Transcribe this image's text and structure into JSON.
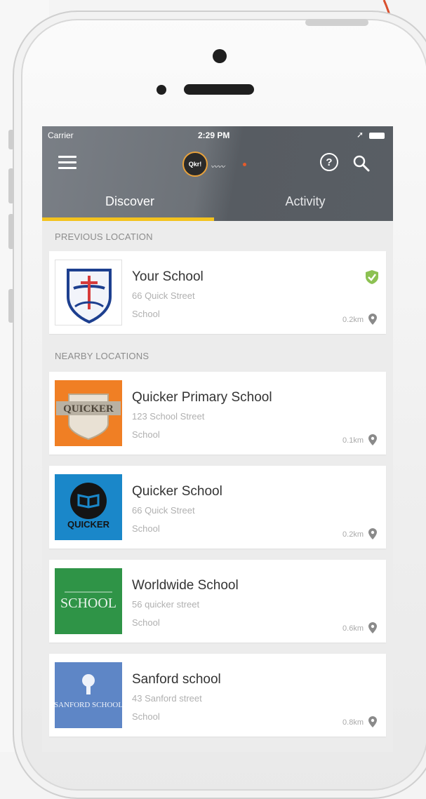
{
  "status_bar": {
    "carrier": "Carrier",
    "time": "2:29 PM"
  },
  "header": {
    "logo_text": "Qkr!"
  },
  "tabs": [
    {
      "label": "Discover",
      "active": true
    },
    {
      "label": "Activity",
      "active": false
    }
  ],
  "sections": {
    "previous": "PREVIOUS LOCATION",
    "nearby": "NEARBY LOCATIONS"
  },
  "previous_location": {
    "name": "Your School",
    "address": "66 Quick Street",
    "type": "School",
    "distance": "0.2km",
    "verified": true
  },
  "nearby_locations": [
    {
      "name": "Quicker Primary School",
      "address": "123 School Street",
      "type": "School",
      "distance": "0.1km",
      "logo_text": "QUICKER"
    },
    {
      "name": "Quicker School",
      "address": "66 Quick Street",
      "type": "School",
      "distance": "0.2km",
      "logo_text": "QUICKER"
    },
    {
      "name": "Worldwide School",
      "address": "56 quicker street",
      "type": "School",
      "distance": "0.6km",
      "logo_text": "SCHOOL"
    },
    {
      "name": "Sanford school",
      "address": "43 Sanford street",
      "type": "School",
      "distance": "0.8km",
      "logo_text": "SANFORD SCHOOL"
    }
  ],
  "colors": {
    "tab_indicator": "#f3c21e",
    "verified_badge": "#8cc152",
    "annotation_arrow": "#d9502e"
  }
}
